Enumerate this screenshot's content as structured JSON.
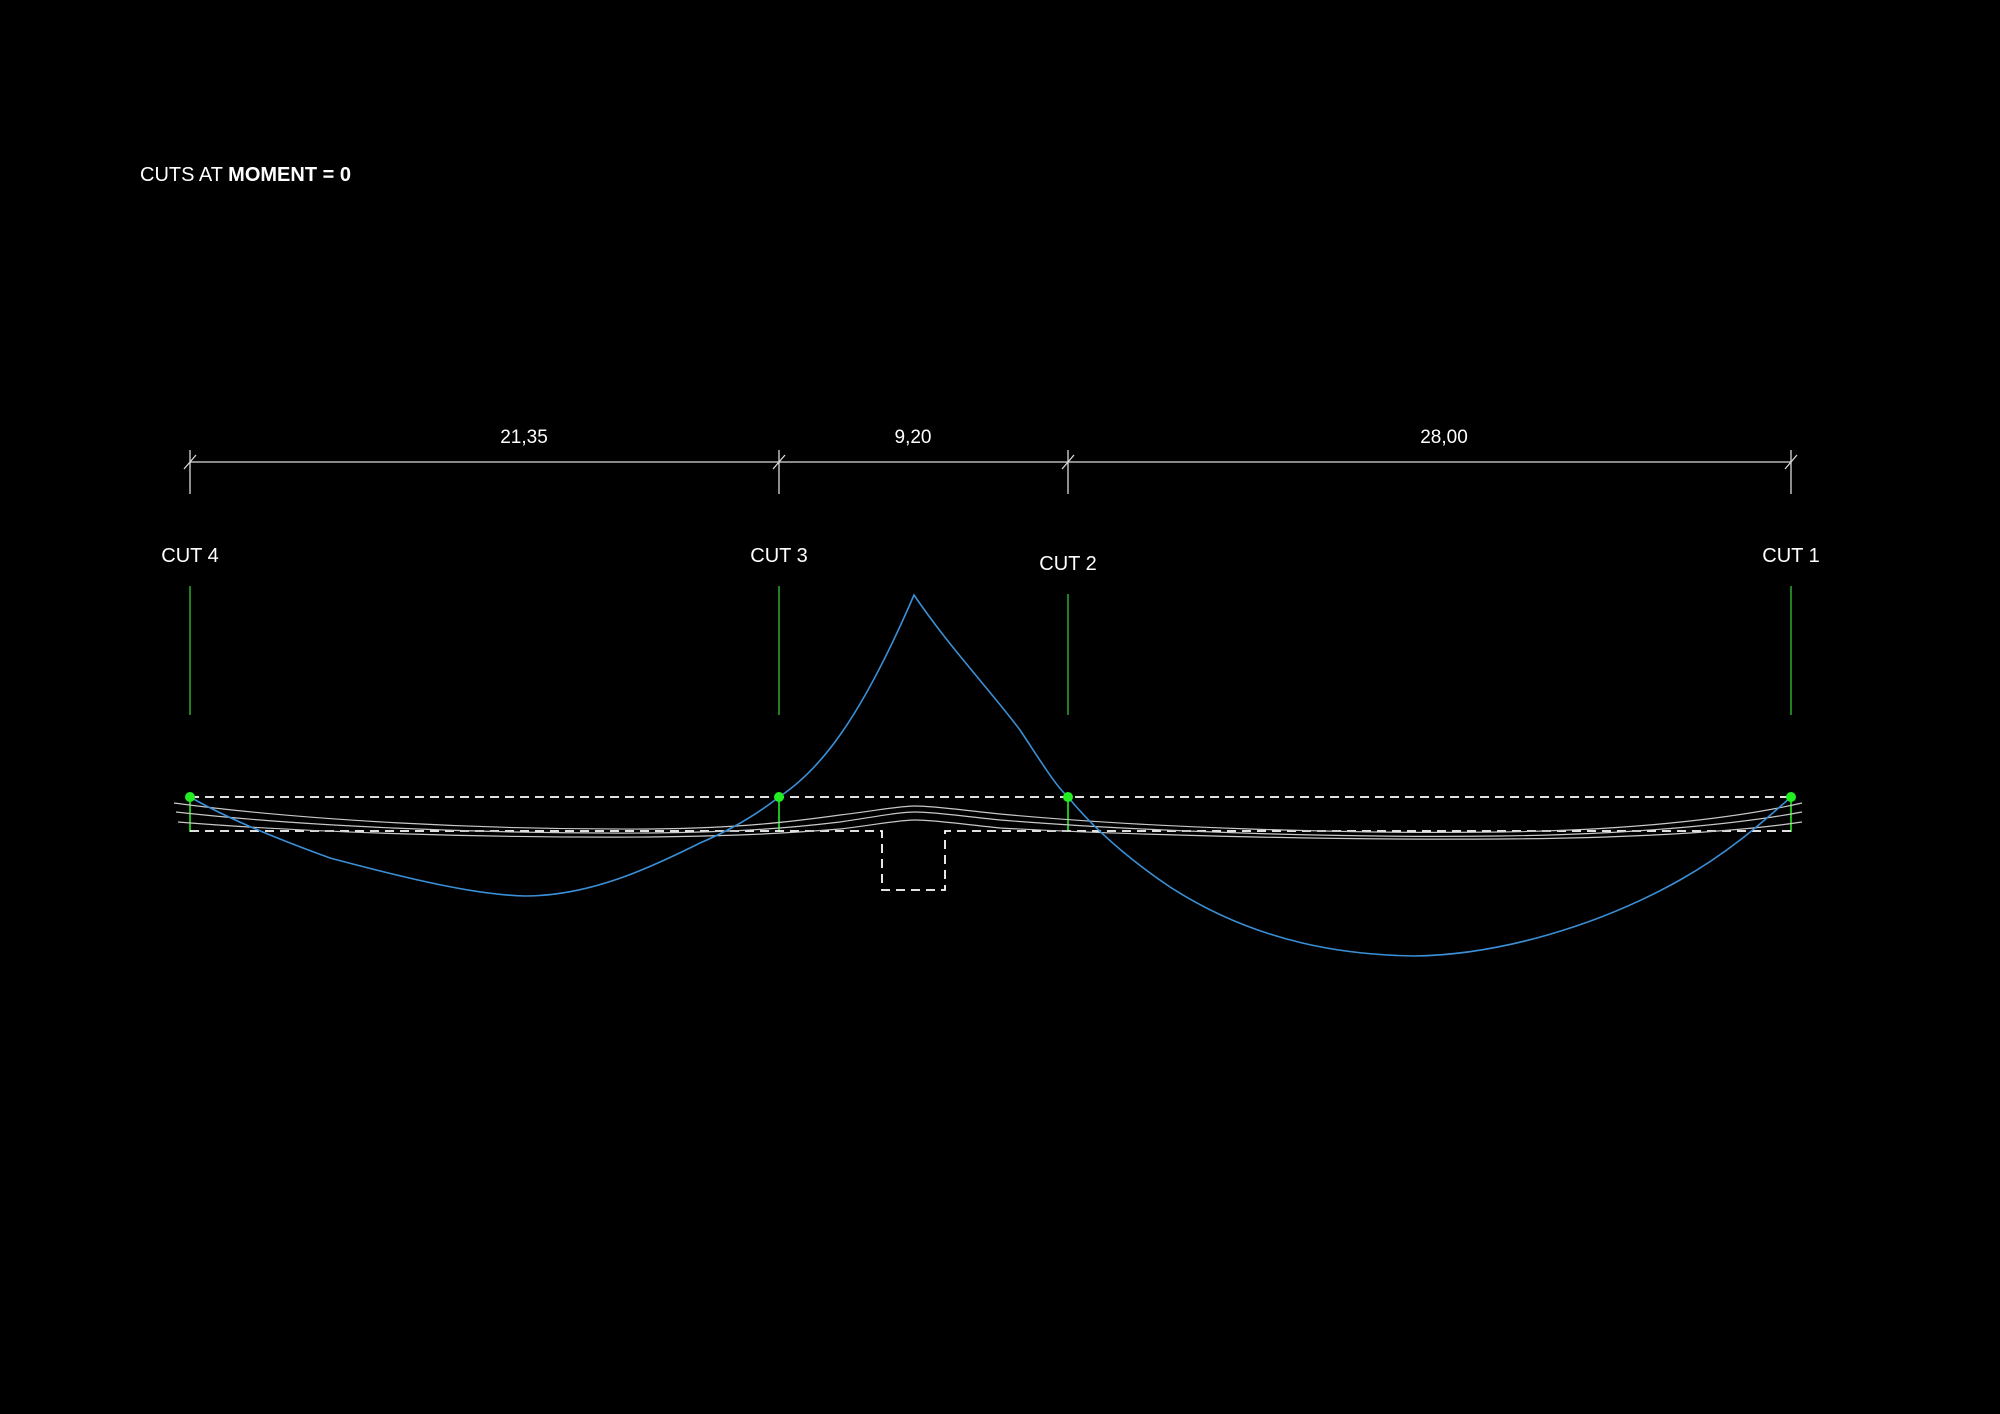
{
  "title": {
    "prefix": "CUTS AT ",
    "emphasis": "MOMENT = 0"
  },
  "dimensions": [
    {
      "label": "21,35"
    },
    {
      "label": "9,20"
    },
    {
      "label": "28,00"
    }
  ],
  "cuts": [
    {
      "label": "CUT 4"
    },
    {
      "label": "CUT 3"
    },
    {
      "label": "CUT 2"
    },
    {
      "label": "CUT 1"
    }
  ],
  "colors": {
    "background": "#000000",
    "moment_curve": "#3a8fd6",
    "cut_marker": "#22ee22",
    "cut_line": "#2e9e2e",
    "text": "#ffffff",
    "dimension": "#d9d9d9"
  }
}
